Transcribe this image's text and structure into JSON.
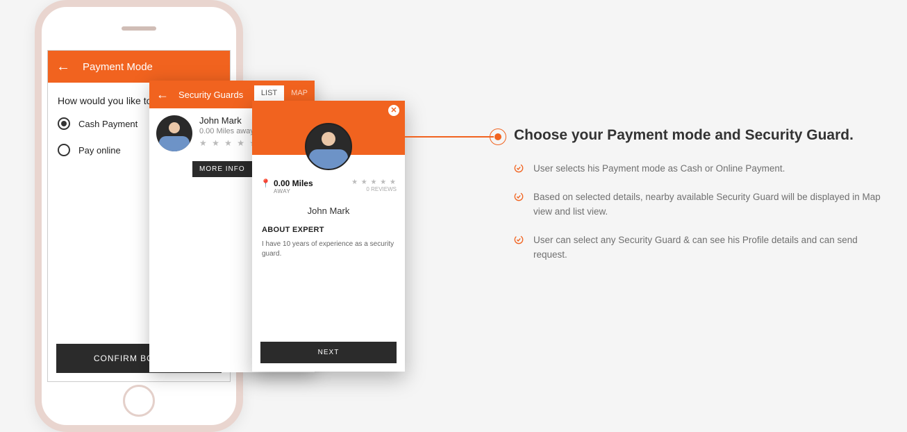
{
  "phone": {
    "payment_mode": {
      "title": "Payment Mode",
      "question": "How would you like to pay?",
      "options": [
        {
          "label": "Cash Payment",
          "checked": true
        },
        {
          "label": "Pay online",
          "checked": false
        }
      ],
      "confirm_label": "CONFIRM BOOKING"
    }
  },
  "overlay_list": {
    "title": "Security Guards",
    "tabs": {
      "list": "LIST",
      "map": "MAP",
      "active": "LIST"
    },
    "guard": {
      "name": "John Mark",
      "distance": "0.00 Miles away"
    },
    "more_info_label": "MORE INFO"
  },
  "overlay_profile": {
    "miles": "0.00 Miles",
    "away": "AWAY",
    "reviews": "0 REVIEWS",
    "name": "John Mark",
    "about_heading": "ABOUT EXPERT",
    "about_text": "I have 10 years of experience as a security guard.",
    "next_label": "NEXT"
  },
  "marketing": {
    "heading": "Choose your Payment mode and Security Guard.",
    "bullets": [
      "User selects his Payment mode as Cash or Online Payment.",
      "Based on selected details, nearby available Security Guard will be displayed in Map view and list view.",
      "User can select any Security Guard & can see his Profile details and can send request."
    ]
  }
}
